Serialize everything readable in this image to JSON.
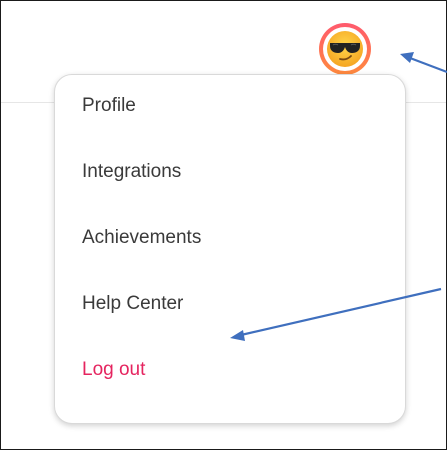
{
  "header": {
    "avatar_icon": "sunglasses-emoji-icon",
    "avatar_ring_colors": [
      "#ff5a6e",
      "#ff8a3d"
    ]
  },
  "menu": {
    "items": [
      {
        "label": "Profile"
      },
      {
        "label": "Integrations"
      },
      {
        "label": "Achievements"
      },
      {
        "label": "Help Center"
      }
    ],
    "logout_label": "Log out",
    "logout_color": "#e5245f"
  },
  "annotations": {
    "arrow_color": "#3f6fbe",
    "arrow_icon": "annotation-arrow-icon"
  }
}
